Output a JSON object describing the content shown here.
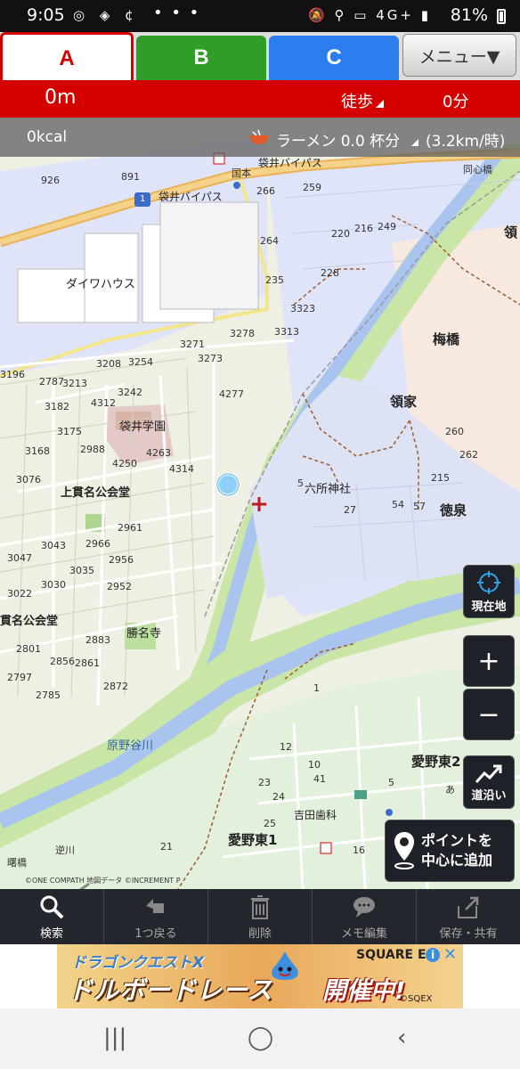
{
  "status_bar": {
    "time": "9:05",
    "signal_text": "4G+",
    "battery": "81%"
  },
  "tabs": [
    {
      "label": "A",
      "color": "#d40000"
    },
    {
      "label": "B",
      "color": "#2e9e26"
    },
    {
      "label": "C",
      "color": "#2c7ef0"
    }
  ],
  "menu_label": "メニュー▼",
  "route": {
    "distance": "0m",
    "mode": "徒歩",
    "time": "0分"
  },
  "calorie": {
    "kcal": "0kcal",
    "food": "ラーメン 0.0 杯分",
    "speed": "(3.2km/時)"
  },
  "map": {
    "labels": {
      "daiwa": "ダイワハウス",
      "fukuroi_gakuen": "袋井学園",
      "kamikanna": "上貫名公会堂",
      "kanna": "貫名公会堂",
      "shomyoji": "勝名寺",
      "haranoyagawa": "原野谷川",
      "umehashi": "梅橋",
      "ryoke": "領家",
      "rokusho": "六所神社",
      "tokusen": "徳泉",
      "aino_higashi1": "愛野東1",
      "aino_higashi2": "愛野東2",
      "yoshida_dental": "吉田歯科",
      "bypass1": "袋井バイパス",
      "bypass2": "袋井バイパス",
      "kokudo": "国本",
      "doshinbashi": "同心橋",
      "sakagawa": "逆川",
      "akebonobashi": "曙橋",
      "ryo_edge": "領",
      "ai_edge": "あ"
    },
    "numbers": [
      "891",
      "926",
      "266",
      "259",
      "264",
      "220",
      "216",
      "249",
      "235",
      "228",
      "3323",
      "3278",
      "3313",
      "3271",
      "3273",
      "3208",
      "3254",
      "4277",
      "3213",
      "3242",
      "4312",
      "3182",
      "2787",
      "3196",
      "3175",
      "4263",
      "3168",
      "2988",
      "4250",
      "4314",
      "3076",
      "2961",
      "3043",
      "2966",
      "3047",
      "3035",
      "2956",
      "3030",
      "2952",
      "3022",
      "2883",
      "2801",
      "2856",
      "2861",
      "2797",
      "2872",
      "2785",
      "260",
      "262",
      "215",
      "5",
      "27",
      "54",
      "57",
      "1",
      "12",
      "10",
      "5",
      "23",
      "24",
      "25",
      "21",
      "16",
      "41"
    ],
    "copyright": "©ONE COMPATH 地図データ ©INCREMENT P"
  },
  "controls": {
    "current_location": "現在地",
    "zoom_in": "+",
    "zoom_out": "−",
    "along_road": "道沿い",
    "add_point_line1": "ポイントを",
    "add_point_line2": "中心に追加"
  },
  "toolbar": [
    {
      "label": "検索",
      "icon": "magnifier-icon"
    },
    {
      "label": "1つ戻る",
      "icon": "undo-icon"
    },
    {
      "label": "削除",
      "icon": "trash-icon"
    },
    {
      "label": "メモ編集",
      "icon": "memo-icon"
    },
    {
      "label": "保存・共有",
      "icon": "share-icon"
    }
  ],
  "ad": {
    "title1": "ドラゴンクエストX",
    "title2": "ドルボードレース",
    "title3": "開催中!",
    "brand": "SQUARE E",
    "copyright": "©SQEX"
  },
  "colors": {
    "accent_red": "#d40000",
    "river": "#a9c4ee",
    "green_bank": "#9ed46a",
    "toolbar_bg": "#23262c"
  }
}
